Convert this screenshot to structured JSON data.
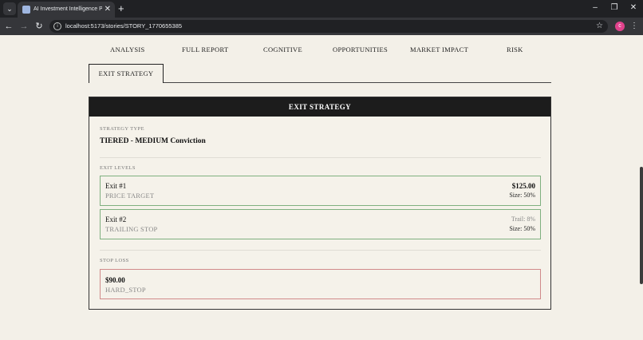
{
  "browser": {
    "tab_title": "AI Investment Intelligence Platf",
    "tab_close": "✕",
    "new_tab": "+",
    "url": "localhost:5173/stories/STORY_1770655385",
    "profile_initial": "c",
    "icons": {
      "back": "back-arrow-icon",
      "forward": "forward-arrow-icon",
      "reload": "reload-icon",
      "star": "star-icon",
      "menu": "kebab-menu-icon"
    }
  },
  "nav": {
    "tabs": [
      {
        "label": "ANALYSIS"
      },
      {
        "label": "FULL REPORT"
      },
      {
        "label": "COGNITIVE"
      },
      {
        "label": "OPPORTUNITIES"
      },
      {
        "label": "MARKET IMPACT"
      },
      {
        "label": "RISK"
      }
    ],
    "active_tab": "EXIT STRATEGY"
  },
  "card": {
    "title": "EXIT STRATEGY",
    "strategy_type_label": "STRATEGY TYPE",
    "strategy_type": "TIERED - MEDIUM Conviction",
    "exit_levels_label": "EXIT LEVELS",
    "exit_levels": [
      {
        "name": "Exit #1",
        "kind": "PRICE TARGET",
        "value": "$125.00",
        "size": "Size: 50%"
      },
      {
        "name": "Exit #2",
        "kind": "TRAILING STOP",
        "value": "Trail: 8%",
        "size": "Size: 50%"
      }
    ],
    "stop_loss_label": "STOP LOSS",
    "stop_loss": {
      "price": "$90.00",
      "kind": "HARD_STOP"
    }
  },
  "colors": {
    "exit_border": "#7fb07f",
    "stop_border": "#d08a8a",
    "header_bg": "#1c1c1c",
    "page_bg": "#f3f0e8"
  }
}
